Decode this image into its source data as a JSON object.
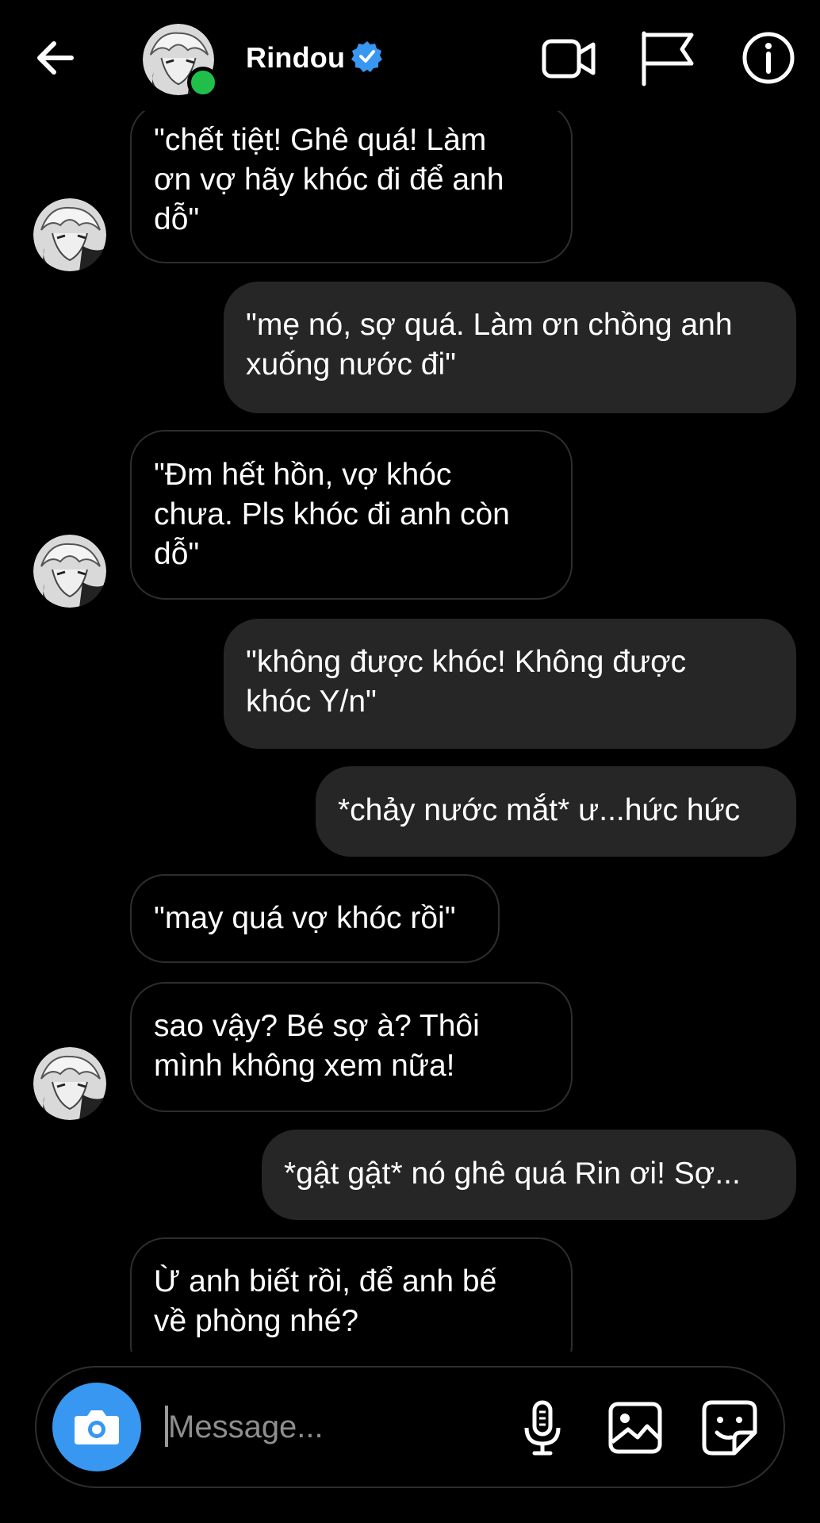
{
  "header": {
    "contact_name": "Rindou",
    "verified": true,
    "online": true,
    "icons": [
      "back-arrow-icon",
      "video-call-icon",
      "report-flag-icon",
      "info-icon"
    ]
  },
  "messages": [
    {
      "side": "in",
      "lines": [
        "\"chết tiệt! Ghê quá! Làm",
        "ơn vợ hãy khóc đi để anh",
        "dỗ\""
      ],
      "avatar": true
    },
    {
      "side": "out",
      "lines": [
        "\"mẹ nó, sợ quá. Làm ơn chồng anh",
        "xuống nước đi\""
      ],
      "avatar": false
    },
    {
      "side": "in",
      "lines": [
        "\"Đm hết hồn, vợ khóc",
        "chưa. Pls khóc đi anh còn",
        "dỗ\""
      ],
      "avatar": true
    },
    {
      "side": "out",
      "lines": [
        "\"không được khóc! Không được",
        "khóc Y/n\""
      ],
      "avatar": false
    },
    {
      "side": "out",
      "lines": [
        "*chảy nước mắt* ư...hức hức"
      ],
      "avatar": false
    },
    {
      "side": "in",
      "lines": [
        "\"may quá vợ khóc rồi\""
      ],
      "avatar": false
    },
    {
      "side": "in",
      "lines": [
        "sao vậy? Bé sợ à? Thôi",
        "mình không xem nữa!"
      ],
      "avatar": true
    },
    {
      "side": "out",
      "lines": [
        "*gật gật* nó ghê quá Rin ơi! Sợ..."
      ],
      "avatar": false
    },
    {
      "side": "in",
      "lines": [
        "Ừ anh biết rồi, để anh bế",
        "về phòng nhé?"
      ],
      "avatar": false
    }
  ],
  "composer": {
    "placeholder": "Message...",
    "icons": [
      "camera-icon",
      "microphone-icon",
      "gallery-icon",
      "sticker-icon"
    ]
  },
  "colors": {
    "background": "#000000",
    "outgoing_bubble": "#262626",
    "incoming_border": "#2e2e2e",
    "camera_button": "#3897f0",
    "verified_badge": "#3897f0",
    "online_dot": "#1fbf4a"
  }
}
